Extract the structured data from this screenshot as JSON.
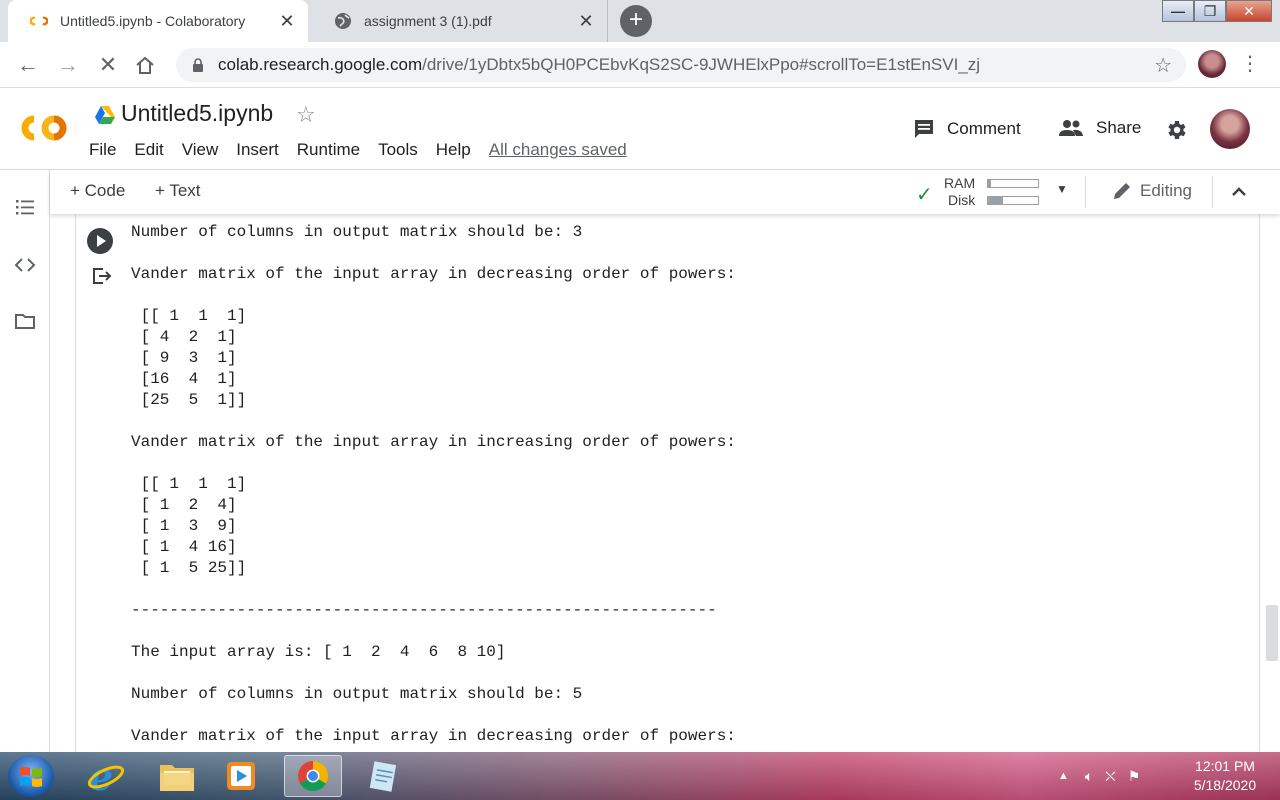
{
  "browser": {
    "tabs": [
      {
        "title": "Untitled5.ipynb - Colaboratory",
        "active": true
      },
      {
        "title": "assignment 3 (1).pdf",
        "active": false
      }
    ],
    "url_host": "colab.research.google.com",
    "url_path": "/drive/1yDbtx5bQH0PCEbvKqS2SC-9JWHElxPpo#scrollTo=E1stEnSVI_zj"
  },
  "colab": {
    "notebook_title": "Untitled5.ipynb",
    "menu": [
      "File",
      "Edit",
      "View",
      "Insert",
      "Runtime",
      "Tools",
      "Help"
    ],
    "save_status": "All changes saved",
    "comment_label": "Comment",
    "share_label": "Share"
  },
  "toolbar": {
    "add_code": "+ Code",
    "add_text": "+ Text",
    "ram_label": "RAM",
    "disk_label": "Disk",
    "ram_usage": 0.05,
    "disk_usage": 0.3,
    "mode_label": "Editing"
  },
  "output": {
    "lines": [
      "Number of columns in output matrix should be: 3",
      "",
      "Vander matrix of the input array in decreasing order of powers:",
      "",
      " [[ 1  1  1]",
      " [ 4  2  1]",
      " [ 9  3  1]",
      " [16  4  1]",
      " [25  5  1]]",
      "",
      "Vander matrix of the input array in increasing order of powers:",
      "",
      " [[ 1  1  1]",
      " [ 1  2  4]",
      " [ 1  3  9]",
      " [ 1  4 16]",
      " [ 1  5 25]]",
      "",
      "-------------------------------------------------------------",
      "",
      "The input array is: [ 1  2  4  6  8 10]",
      "",
      "Number of columns in output matrix should be: 5",
      "",
      "Vander matrix of the input array in decreasing order of powers:"
    ]
  },
  "taskbar": {
    "time": "12:01 PM",
    "date": "5/18/2020",
    "apps": [
      "start-orb",
      "internet-explorer",
      "file-explorer",
      "media-player",
      "google-chrome",
      "notepad"
    ]
  },
  "colors": {
    "colab_orange": "#f9ab00",
    "check_green": "#1e8e3e",
    "chrome_bg": "#dee1e6"
  }
}
